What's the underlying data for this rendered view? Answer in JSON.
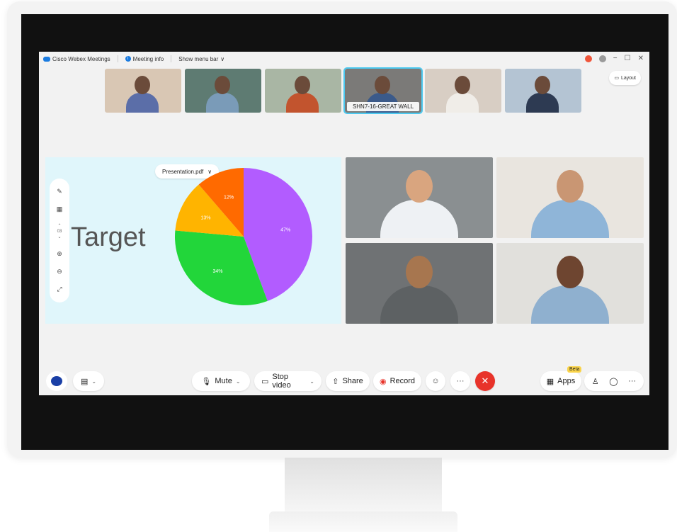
{
  "titlebar": {
    "app_name": "Cisco Webex Meetings",
    "meeting_info": "Meeting info",
    "show_menu": "Show menu bar",
    "chevron": "∨",
    "minimize": "−",
    "maximize": "☐",
    "close": "✕"
  },
  "thumbnails": [
    {
      "label": "",
      "bg": "#d9c7b4",
      "shirt": "#5b6ea8",
      "active": false
    },
    {
      "label": "",
      "bg": "#5e7b72",
      "shirt": "#7a9bb8",
      "active": false
    },
    {
      "label": "",
      "bg": "#a9b6a4",
      "shirt": "#c2542e",
      "active": false
    },
    {
      "label": "SHN7-16-GREAT WALL",
      "bg": "#7b7a78",
      "shirt": "#3b5a8a",
      "active": true
    },
    {
      "label": "",
      "bg": "#d8cec4",
      "shirt": "#f0ede8",
      "active": false
    },
    {
      "label": "",
      "bg": "#b4c4d3",
      "shirt": "#2d3a52",
      "active": false
    }
  ],
  "layout_button": "Layout",
  "presentation": {
    "file_name": "Presentation.pdf",
    "file_chevron": "∨",
    "page_number": "03",
    "heading": "Target"
  },
  "chart_data": {
    "type": "pie",
    "title": "",
    "slices": [
      {
        "label": "47%",
        "value": 47,
        "color": "#b25cff"
      },
      {
        "label": "34%",
        "value": 34,
        "color": "#22d63a"
      },
      {
        "label": "13%",
        "value": 13,
        "color": "#ffb400"
      },
      {
        "label": "12%",
        "value": 12,
        "color": "#ff6a00"
      }
    ]
  },
  "videos": [
    {
      "bg": "#8a8f91",
      "skin": "#d9a57f",
      "shirt": "#eef1f4"
    },
    {
      "bg": "#e9e5df",
      "skin": "#c99673",
      "shirt": "#8fb5d8"
    },
    {
      "bg": "#6f7274",
      "skin": "#a7764f",
      "shirt": "#5d6163"
    },
    {
      "bg": "#e1e0dc",
      "skin": "#6e4530",
      "shirt": "#8fb0cf"
    }
  ],
  "toolbar": {
    "mute_label": "Mute",
    "stop_video_label": "Stop video",
    "share_label": "Share",
    "record_label": "Record",
    "apps_label": "Apps",
    "beta_label": "Beta",
    "more_label": "···",
    "end_label": "✕",
    "dropdown_chevron": "⌄"
  },
  "colors": {
    "accent": "#1a7be0",
    "end_call": "#e8332a",
    "active_thumb_outline": "#4cc9f0",
    "presentation_bg": "#e0f6fb"
  }
}
